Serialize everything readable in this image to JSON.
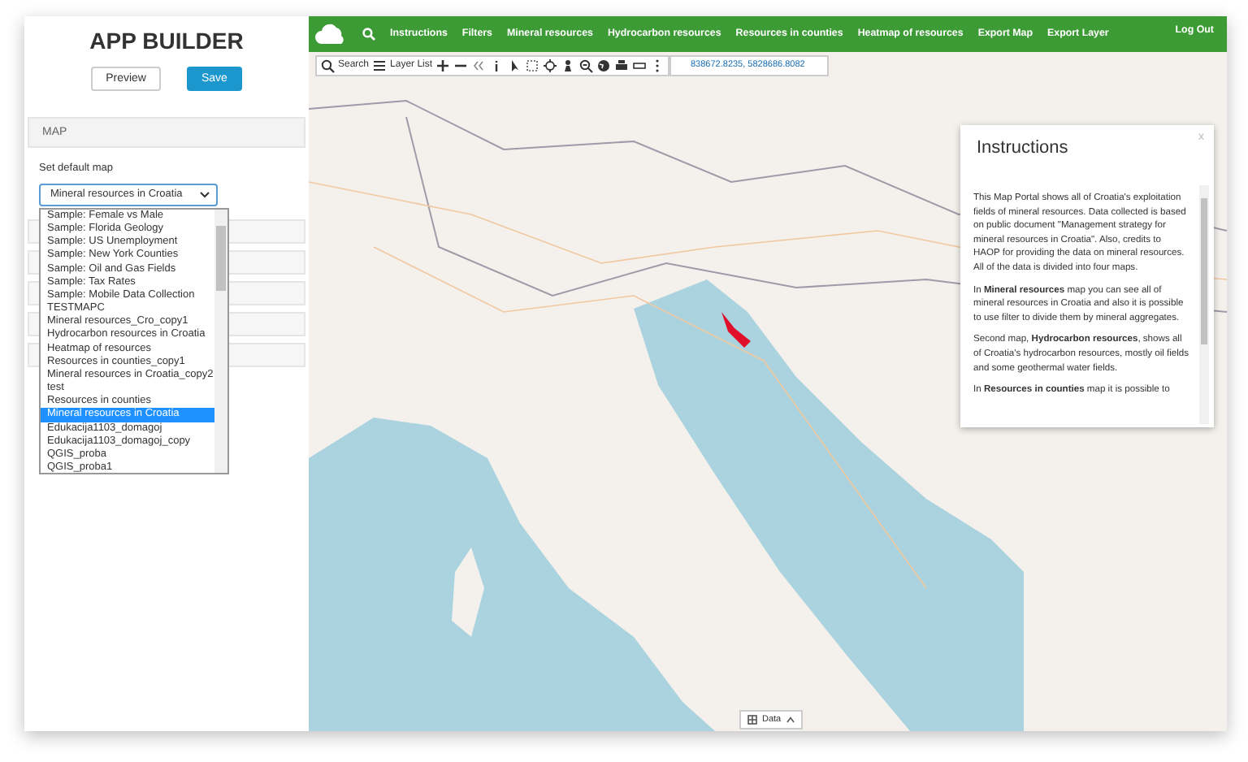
{
  "app_title": "APP BUILDER",
  "buttons": [
    {
      "label": "Preview",
      "kind": "secondary"
    },
    {
      "label": "Save",
      "kind": "primary"
    }
  ],
  "section": {
    "title": "MAP",
    "field_label": "Set default map",
    "select_value": "Mineral resources in Croatia",
    "options": [
      {
        "label": "Sample: Female vs Male",
        "selected": false
      },
      {
        "label": "Sample: Florida Geology",
        "selected": false
      },
      {
        "label": "Sample: US Unemployment",
        "selected": false
      },
      {
        "label": "Sample: New York Counties",
        "selected": false
      },
      {
        "label": "Sample: Oil and Gas Fields",
        "selected": false
      },
      {
        "label": "Sample: Tax Rates",
        "selected": false
      },
      {
        "label": "Sample: Mobile Data Collection",
        "selected": false
      },
      {
        "label": "TESTMAPC",
        "selected": false
      },
      {
        "label": "Mineral resources_Cro_copy1",
        "selected": false
      },
      {
        "label": "Hydrocarbon resources in Croatia",
        "selected": false
      },
      {
        "label": "Heatmap of resources",
        "selected": false
      },
      {
        "label": "Resources in counties_copy1",
        "selected": false
      },
      {
        "label": "Mineral resources in Croatia_copy2",
        "selected": false
      },
      {
        "label": "test",
        "selected": false
      },
      {
        "label": "Resources in counties",
        "selected": false
      },
      {
        "label": "Mineral resources in Croatia",
        "selected": true
      },
      {
        "label": "Edukacija1103_domagoj",
        "selected": false
      },
      {
        "label": "Edukacija1103_domagoj_copy",
        "selected": false
      },
      {
        "label": "QGIS_proba",
        "selected": false
      },
      {
        "label": "QGIS_proba1",
        "selected": false
      }
    ]
  },
  "nav": {
    "items": [
      "Instructions",
      "Filters",
      "Mineral resources",
      "Hydrocarbon resources",
      "Resources in counties",
      "Heatmap of resources",
      "Export Map",
      "Export Layer"
    ],
    "logout": "Log Out"
  },
  "toolbar": {
    "search": "Search",
    "layer_list": "Layer List",
    "coordinates": "838672.8235, 5828686.8082"
  },
  "dialog": {
    "title": "Instructions",
    "close": "x",
    "paragraphs": [
      "This Map Portal shows all of Croatia's exploitation fields of mineral resources. Data collected is based on public document \"Management strategy for mineral resources in Croatia\". Also, credits to HAOP for providing the data on mineral resources. All of the data is divided into four maps.",
      "In **Mineral resources** map you can see all of mineral resources in Croatia and also it is possible to use filter to divide them by mineral aggregates.",
      "Second map, **Hydrocarbon resources**, shows all of Croatia's hydrocarbon resources, mostly oil fields and some geothermal water fields.",
      "In **Resources in counties** map it is possible to"
    ]
  },
  "map": {
    "attribution_button": "Data"
  }
}
